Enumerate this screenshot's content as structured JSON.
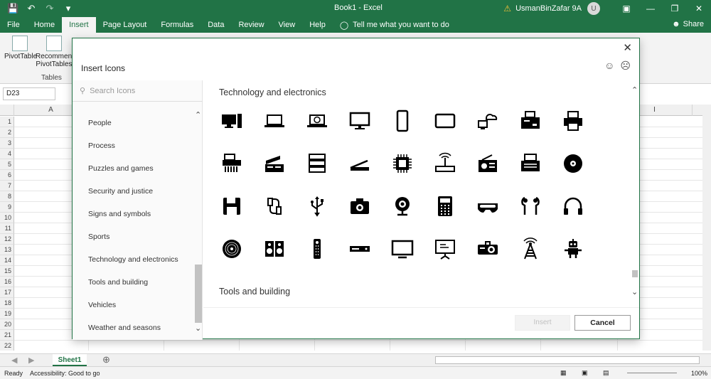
{
  "titlebar": {
    "title": "Book1  -  Excel",
    "user": "UsmanBinZafar 9A",
    "avatar_initial": "U",
    "qat_icons": [
      "save-icon",
      "undo-icon",
      "redo-icon",
      "customize-icon"
    ]
  },
  "tabs": [
    {
      "label": "File"
    },
    {
      "label": "Home"
    },
    {
      "label": "Insert",
      "active": true
    },
    {
      "label": "Page Layout"
    },
    {
      "label": "Formulas"
    },
    {
      "label": "Data"
    },
    {
      "label": "Review"
    },
    {
      "label": "View"
    },
    {
      "label": "Help"
    }
  ],
  "tellme": "Tell me what you want to do",
  "share": "Share",
  "ribbon": {
    "pivottable": "PivotTable",
    "recommended": "Recommended PivotTables",
    "group_label": "Tables"
  },
  "formula": {
    "namebox": "D23"
  },
  "columns": [
    "A",
    "I"
  ],
  "rows": [
    "1",
    "2",
    "3",
    "4",
    "5",
    "6",
    "7",
    "8",
    "9",
    "10",
    "11",
    "12",
    "13",
    "14",
    "15",
    "16",
    "17",
    "18",
    "19",
    "20",
    "21",
    "22"
  ],
  "sheet": {
    "tab": "Sheet1"
  },
  "status": {
    "ready": "Ready",
    "accessibility": "Accessibility: Good to go",
    "zoom": "100%"
  },
  "dialog": {
    "title": "Insert Icons",
    "search_placeholder": "Search Icons",
    "categories": [
      "People",
      "Process",
      "Puzzles and games",
      "Security and justice",
      "Signs and symbols",
      "Sports",
      "Technology and electronics",
      "Tools and building",
      "Vehicles",
      "Weather and seasons"
    ],
    "section_title": "Technology and electronics",
    "next_section_title": "Tools and building",
    "icons": [
      "desktop-computer-icon",
      "laptop-icon",
      "laptop-globe-icon",
      "monitor-icon",
      "smartphone-icon",
      "tablet-icon",
      "cloud-computer-icon",
      "fax-machine-icon",
      "printer-icon",
      "paper-shredder-icon",
      "server-rack-icon",
      "database-server-icon",
      "flatbed-scanner-icon",
      "processor-chip-icon",
      "wireless-router-icon",
      "radio-icon",
      "typewriter-icon",
      "optical-disc-icon",
      "floppy-disk-icon",
      "power-plug-icon",
      "usb-icon",
      "camera-icon",
      "webcam-icon",
      "calculator-icon",
      "vr-headset-icon",
      "earbuds-icon",
      "headphones-icon",
      "vinyl-record-icon",
      "speakers-icon",
      "remote-control-icon",
      "dvd-player-icon",
      "television-icon",
      "projector-screen-icon",
      "video-projector-icon",
      "radio-tower-icon",
      "robot-icon"
    ],
    "insert_label": "Insert",
    "cancel_label": "Cancel"
  }
}
